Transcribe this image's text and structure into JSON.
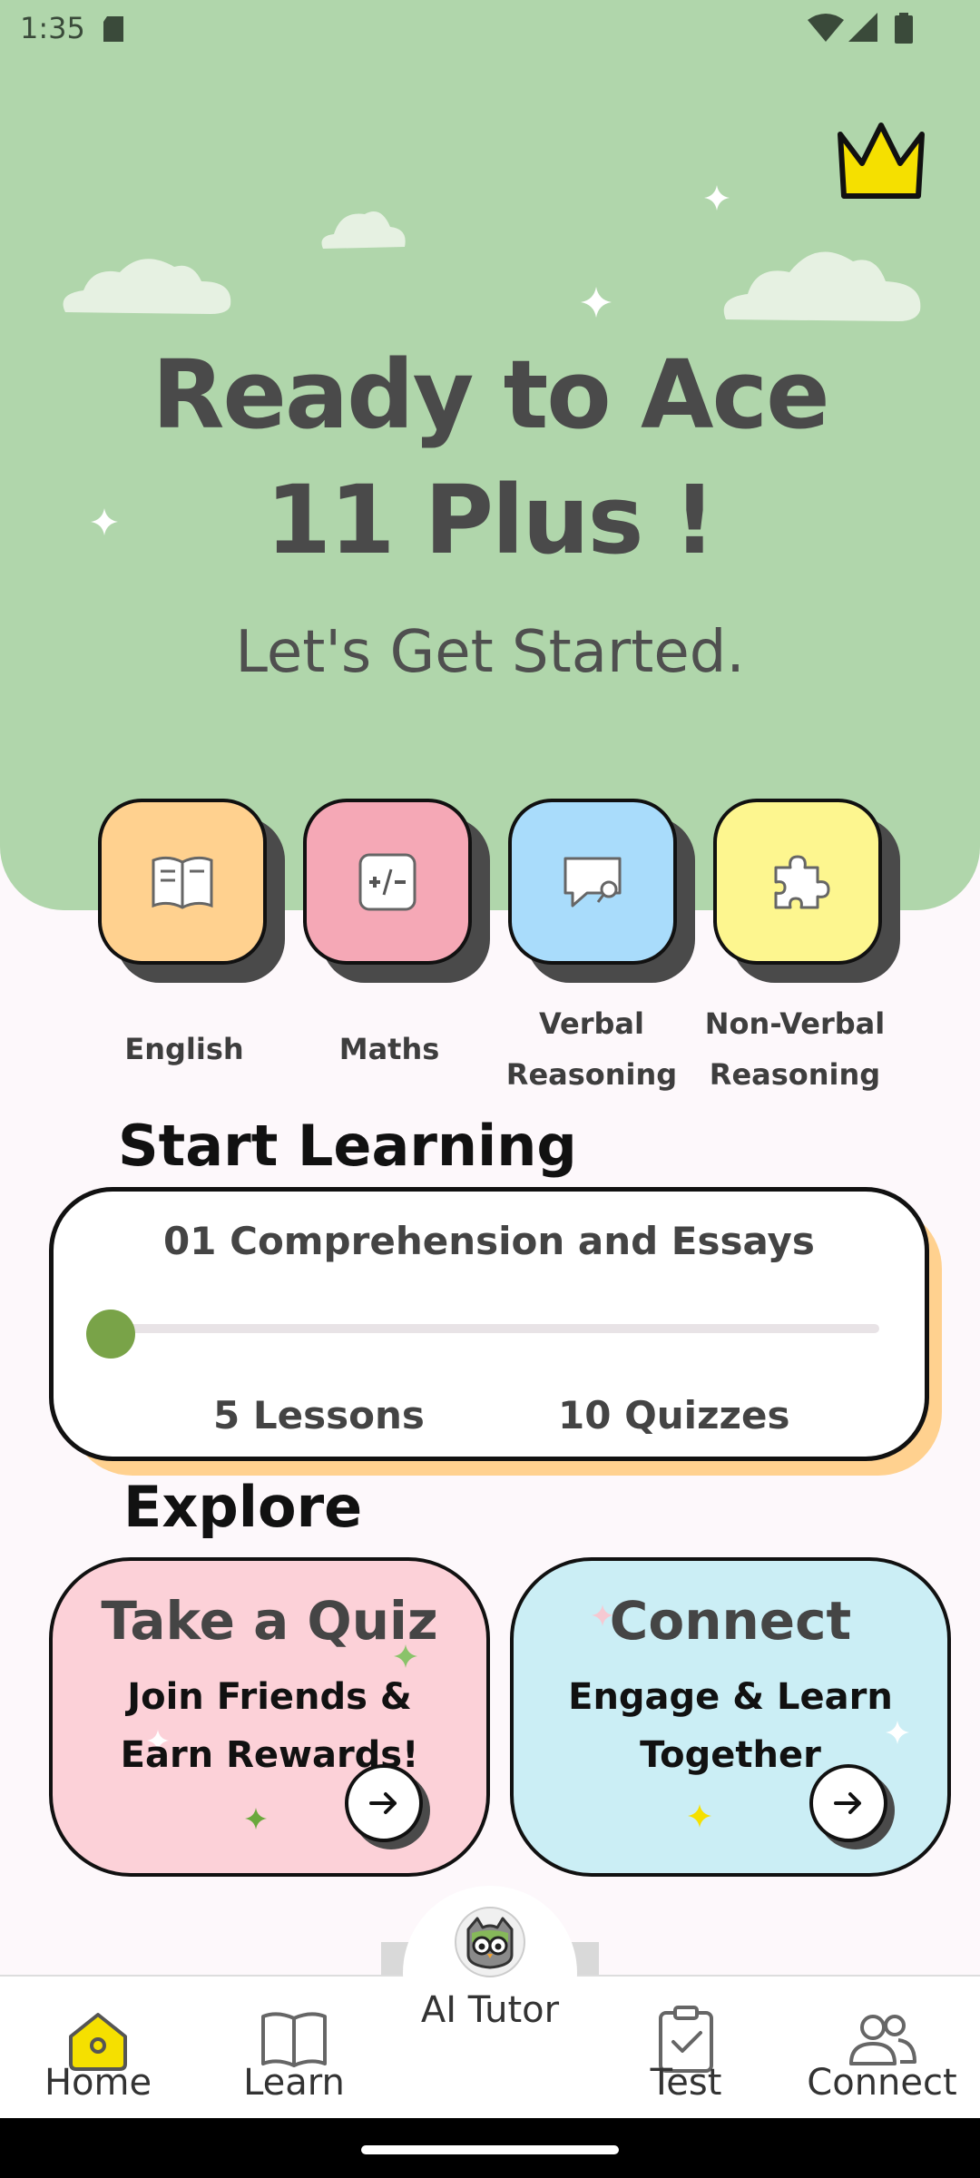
{
  "status_bar": {
    "time": "1:35"
  },
  "hero": {
    "title_line1": "Ready to Ace",
    "title_line2": "11 Plus !",
    "subtitle": "Let's Get Started."
  },
  "subjects": [
    {
      "label_line1": "English",
      "label_line2": "",
      "color": "#ffd18f",
      "icon": "book-icon"
    },
    {
      "label_line1": "Maths",
      "label_line2": "",
      "color": "#f5a8b6",
      "icon": "math-icon"
    },
    {
      "label_line1": "Verbal",
      "label_line2": "Reasoning",
      "color": "#a9dcfb",
      "icon": "chat-icon"
    },
    {
      "label_line1": "Non-Verbal",
      "label_line2": "Reasoning",
      "color": "#fdf68f",
      "icon": "puzzle-icon"
    }
  ],
  "start_learning": {
    "heading": "Start Learning",
    "course_title": "01 Comprehension and Essays",
    "progress": 0.0,
    "lessons": "5 Lessons",
    "quizzes": "10 Quizzes"
  },
  "explore": {
    "heading": "Explore",
    "cards": [
      {
        "title": "Take a Quiz",
        "subtitle": "Join Friends & Earn Rewards!",
        "color": "#fcd1d8"
      },
      {
        "title": "Connect",
        "subtitle": "Engage & Learn Together",
        "color": "#cbeef5"
      }
    ]
  },
  "nav": {
    "home": "Home",
    "learn": "Learn",
    "tutor": "AI Tutor",
    "test": "Test",
    "connect": "Connect",
    "active": "Home"
  },
  "colors": {
    "hero_bg": "#b0d6ab",
    "progress": "#79a348",
    "card_shadow": "#ffd18f",
    "crown": "#f5e000"
  }
}
